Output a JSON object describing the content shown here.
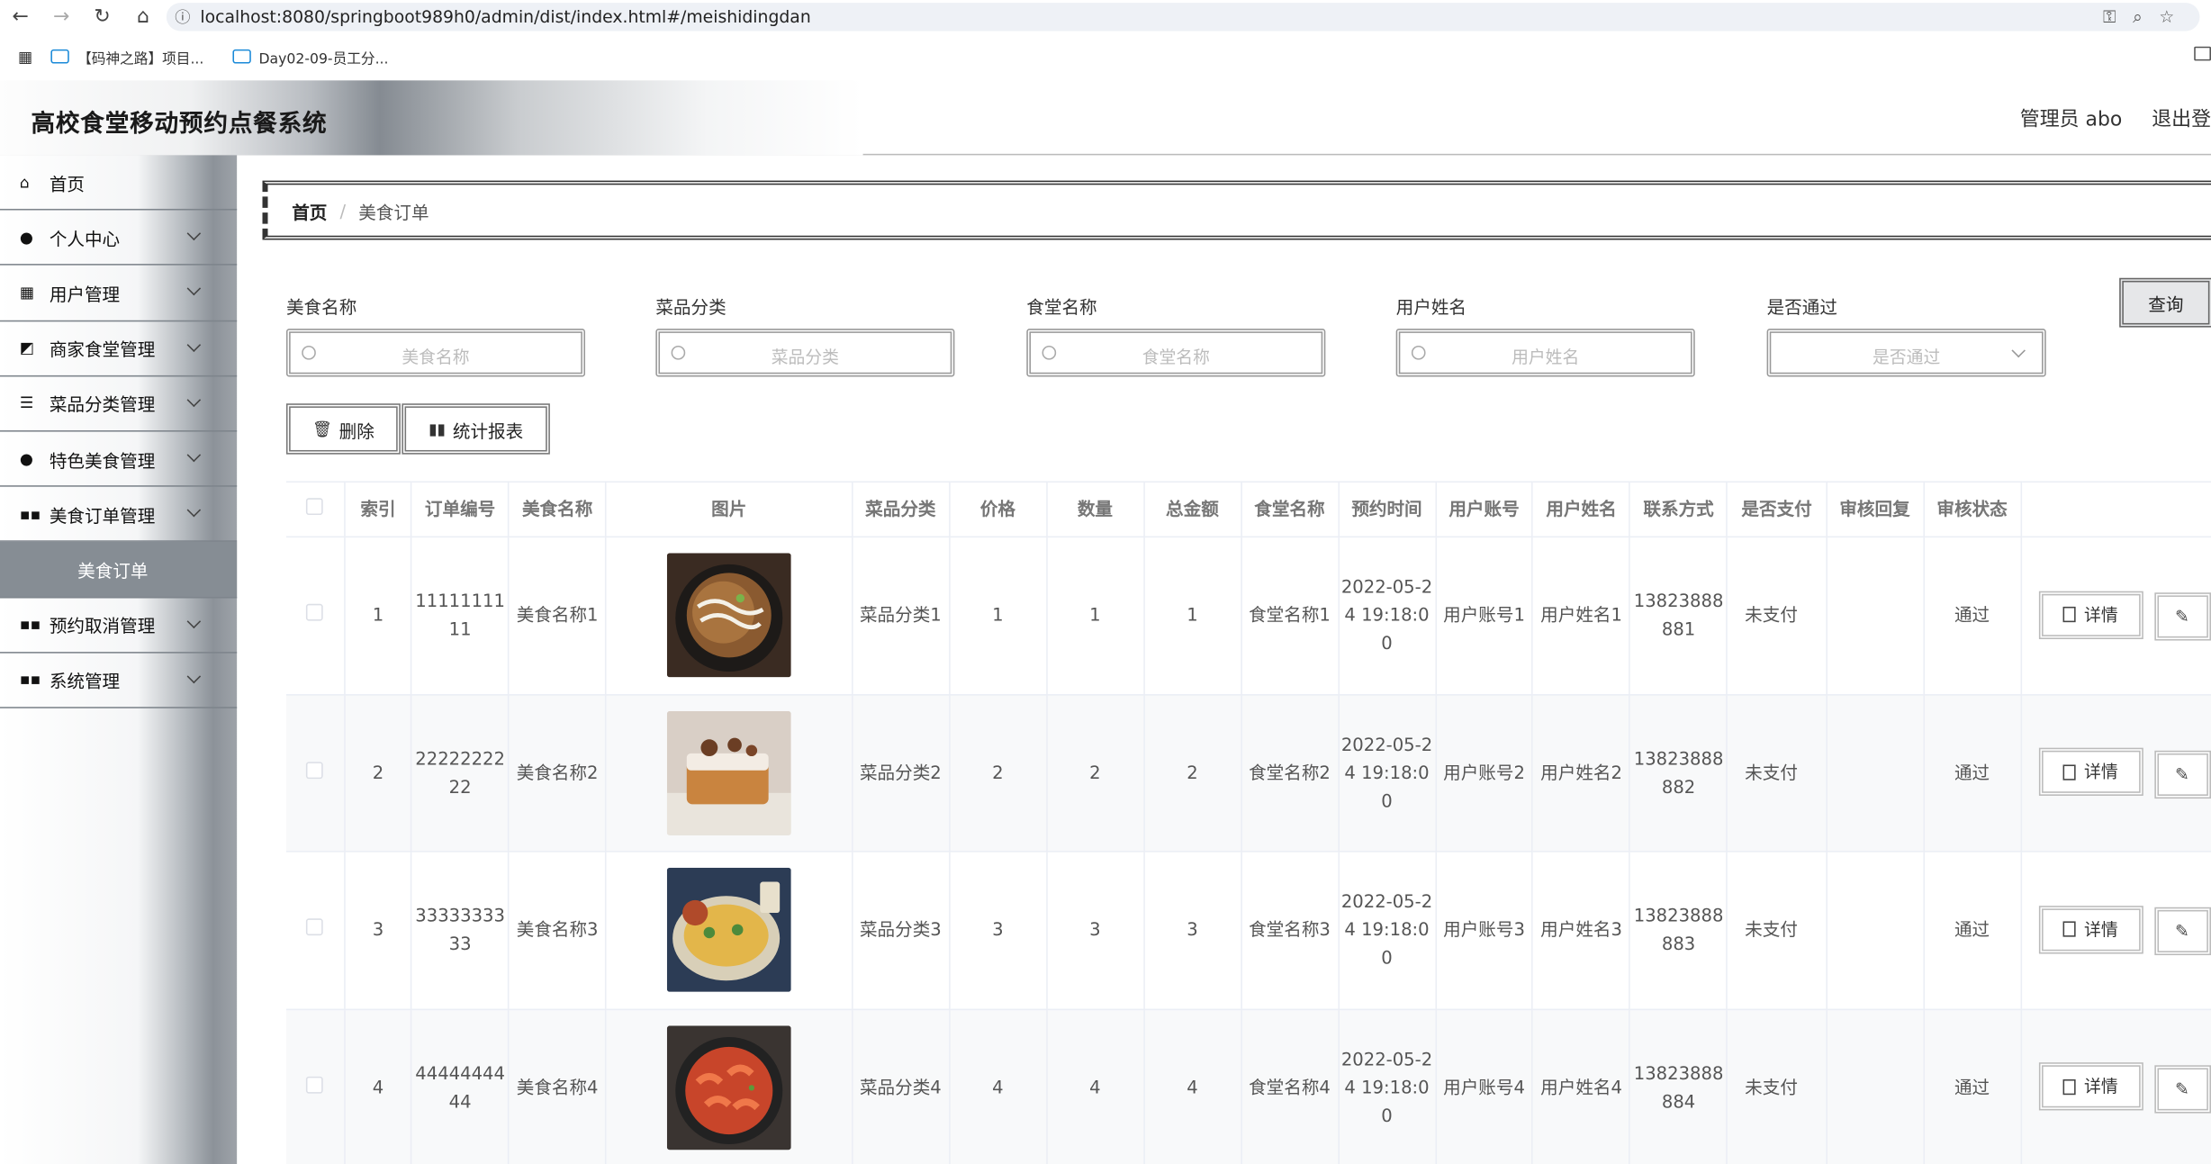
{
  "browser": {
    "url": "localhost:8080/springboot989h0/admin/dist/index.html#/meishidingdan",
    "bookmarks": [
      "【码神之路】项目...",
      "Day02-09-员工分..."
    ]
  },
  "header": {
    "title": "高校食堂移动预约点餐系统",
    "user_label": "管理员 abo",
    "logout_label": "退出登"
  },
  "sidebar": {
    "items": [
      {
        "label": "首页",
        "icon": "home-icon"
      },
      {
        "label": "个人中心",
        "icon": "user-icon"
      },
      {
        "label": "用户管理",
        "icon": "grid-icon"
      },
      {
        "label": "商家食堂管理",
        "icon": "chart-icon"
      },
      {
        "label": "菜品分类管理",
        "icon": "list-icon"
      },
      {
        "label": "特色美食管理",
        "icon": "bulb-icon"
      },
      {
        "label": "美食订单管理",
        "icon": "apps-icon"
      },
      {
        "label": "预约取消管理",
        "icon": "apps-icon"
      },
      {
        "label": "系统管理",
        "icon": "apps-icon"
      }
    ],
    "active_sub": "美食订单"
  },
  "breadcrumb": {
    "home": "首页",
    "sep": "/",
    "current": "美食订单"
  },
  "filters": [
    {
      "label": "美食名称",
      "placeholder": "美食名称"
    },
    {
      "label": "菜品分类",
      "placeholder": "菜品分类"
    },
    {
      "label": "食堂名称",
      "placeholder": "食堂名称"
    },
    {
      "label": "用户姓名",
      "placeholder": "用户姓名"
    },
    {
      "label": "是否通过",
      "placeholder": "是否通过"
    }
  ],
  "buttons": {
    "query": "查询",
    "delete": "删除",
    "report": "统计报表",
    "detail": "详情"
  },
  "table": {
    "columns": [
      "索引",
      "订单编号",
      "美食名称",
      "图片",
      "菜品分类",
      "价格",
      "数量",
      "总金额",
      "食堂名称",
      "预约时间",
      "用户账号",
      "用户姓名",
      "联系方式",
      "是否支付",
      "审核回复",
      "审核状态"
    ],
    "rows": [
      {
        "index": "1",
        "order_no": "1111111111",
        "food": "美食名称1",
        "category": "菜品分类1",
        "price": "1",
        "qty": "1",
        "total": "1",
        "canteen": "食堂名称1",
        "time": "2022-05-24 19:18:00",
        "account": "用户账号1",
        "username": "用户姓名1",
        "phone": "13823888881",
        "paid": "未支付",
        "reply": "",
        "status": "通过"
      },
      {
        "index": "2",
        "order_no": "2222222222",
        "food": "美食名称2",
        "category": "菜品分类2",
        "price": "2",
        "qty": "2",
        "total": "2",
        "canteen": "食堂名称2",
        "time": "2022-05-24 19:18:00",
        "account": "用户账号2",
        "username": "用户姓名2",
        "phone": "13823888882",
        "paid": "未支付",
        "reply": "",
        "status": "通过"
      },
      {
        "index": "3",
        "order_no": "3333333333",
        "food": "美食名称3",
        "category": "菜品分类3",
        "price": "3",
        "qty": "3",
        "total": "3",
        "canteen": "食堂名称3",
        "time": "2022-05-24 19:18:00",
        "account": "用户账号3",
        "username": "用户姓名3",
        "phone": "13823888883",
        "paid": "未支付",
        "reply": "",
        "status": "通过"
      },
      {
        "index": "4",
        "order_no": "4444444444",
        "food": "美食名称4",
        "category": "菜品分类4",
        "price": "4",
        "qty": "4",
        "total": "4",
        "canteen": "食堂名称4",
        "time": "2022-05-24 19:18:00",
        "account": "用户账号4",
        "username": "用户姓名4",
        "phone": "13823888884",
        "paid": "未支付",
        "reply": "",
        "status": "通过"
      }
    ]
  }
}
